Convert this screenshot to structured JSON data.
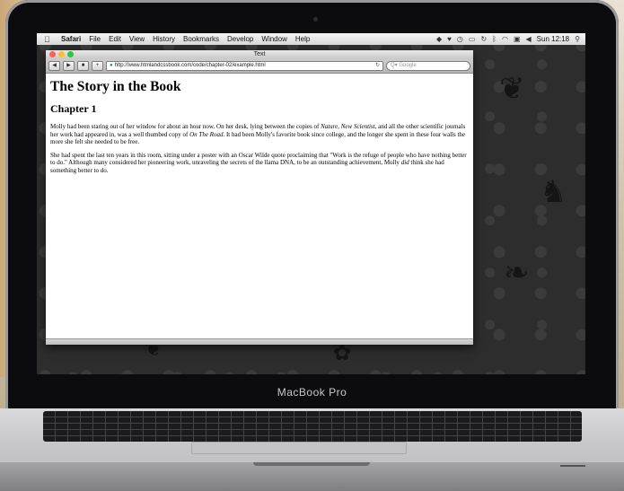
{
  "menubar": {
    "app": "Safari",
    "items": [
      "File",
      "Edit",
      "View",
      "History",
      "Bookmarks",
      "Develop",
      "Window",
      "Help"
    ],
    "clock": "Sun 12:18"
  },
  "window": {
    "title": "Text",
    "url": "http://www.htmlandcssbook.com/code/chapter-02/example.html",
    "search_placeholder": "Q▾ Google"
  },
  "page": {
    "heading": "The Story in the Book",
    "subheading": "Chapter 1",
    "p1": {
      "a": "Molly had been staring out of her window for about an hour now. On her desk, lying between the copies of ",
      "i1": "Nature",
      "b": ", ",
      "i2": "New Scientist",
      "c": ", and all the other scientific journals her work had appeared in, was a well thumbed copy of ",
      "i3": "On The Road",
      "d": ". It had been Molly's favorite book since college, and the longer she spent in these four walls the more she felt she needed to be free."
    },
    "p2": {
      "a": "She had spent the last ten years in this room, sitting under a poster with an Oscar Wilde quote proclaiming that \"Work is the refuge of people who have nothing better to do.\" Although many considered her pioneering work, unraveling the secrets of the llama DNA, to be an outstanding achievement, Molly ",
      "i1": "did",
      "b": " think she had something better to do."
    }
  },
  "laptop": {
    "brand": "MacBook Pro"
  },
  "colors": {
    "close": "#ff5f57",
    "minimize": "#ffbd2e",
    "zoom": "#28c940"
  }
}
